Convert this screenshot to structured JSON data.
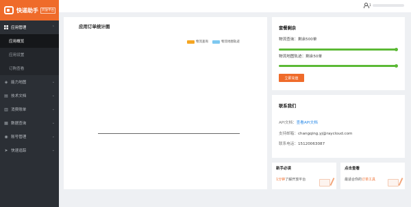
{
  "brand": {
    "name": "快递助手",
    "tag": "开放平台"
  },
  "user": {
    "prefix": "1"
  },
  "sidebar": {
    "items": [
      {
        "label": "应用管理",
        "icon": "grid-icon",
        "type": "group"
      },
      {
        "label": "应用概览",
        "type": "sub",
        "active": true
      },
      {
        "label": "应用设置",
        "type": "sub"
      },
      {
        "label": "订购查看",
        "type": "sub"
      },
      {
        "label": "能力地图",
        "icon": "map-icon",
        "type": "item"
      },
      {
        "label": "技术文档",
        "icon": "book-icon",
        "type": "item"
      },
      {
        "label": "消费账单",
        "icon": "bill-icon",
        "type": "item"
      },
      {
        "label": "数据查询",
        "icon": "database-icon",
        "type": "item"
      },
      {
        "label": "账号管理",
        "icon": "user-icon",
        "type": "item"
      },
      {
        "label": "快速追踪",
        "icon": "paper-plane-icon",
        "type": "item"
      }
    ]
  },
  "chart": {
    "title": "应用订单统计图",
    "legend": [
      {
        "label": "物流查询",
        "color": "#f5a623"
      },
      {
        "label": "物流地图轨迹",
        "color": "#7ec8f0"
      }
    ]
  },
  "package": {
    "title": "套餐剩余",
    "items": [
      {
        "label": "物流查询：剩余500单",
        "progress": 1.0
      },
      {
        "label": "物流地图轨迹：剩余50单",
        "progress": 1.0
      }
    ],
    "button": "立即充值"
  },
  "contact": {
    "title": "联系我们",
    "api_label": "API文档：",
    "api_link": "查看API文档",
    "email_label": "支持邮箱：",
    "email": "changqing.yj@raycloud.com",
    "phone_label": "联系电话：",
    "phone": "15120063087"
  },
  "guide": {
    "title": "新手必读",
    "highlight": "1分钟",
    "text": "了解开放平台"
  },
  "view": {
    "title": "点击查看",
    "text": "最适合你的",
    "highlight": "订单工具"
  },
  "colors": {
    "accent": "#ef6b2a",
    "sidebar_bg": "#2b2f35",
    "progress": "#5bb935",
    "link": "#2b8be8"
  }
}
